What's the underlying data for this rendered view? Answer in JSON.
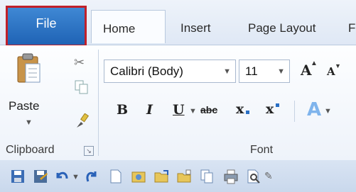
{
  "tabs": {
    "file": "File",
    "home": "Home",
    "insert": "Insert",
    "page_layout": "Page Layout",
    "partial": "F"
  },
  "clipboard": {
    "paste": "Paste",
    "group_label": "Clipboard"
  },
  "font": {
    "name": "Calibri (Body)",
    "size": "11",
    "group_label": "Font",
    "grow": "A",
    "shrink": "A",
    "bold": "B",
    "italic": "I",
    "underline": "U",
    "strike": "abc",
    "subscript": "x",
    "superscript": "x",
    "effects": "A"
  },
  "colors": {
    "file_tab": "#1f63b5",
    "highlight_border": "#c0202a",
    "ribbon_bg": "#eef3fa"
  },
  "qat_icons": [
    "save-icon",
    "save-as-icon",
    "undo-icon",
    "redo-icon",
    "new-document-icon",
    "insert-picture-icon",
    "open-folder-icon",
    "open-recent-icon",
    "copy-document-icon",
    "print-icon",
    "print-preview-icon"
  ]
}
